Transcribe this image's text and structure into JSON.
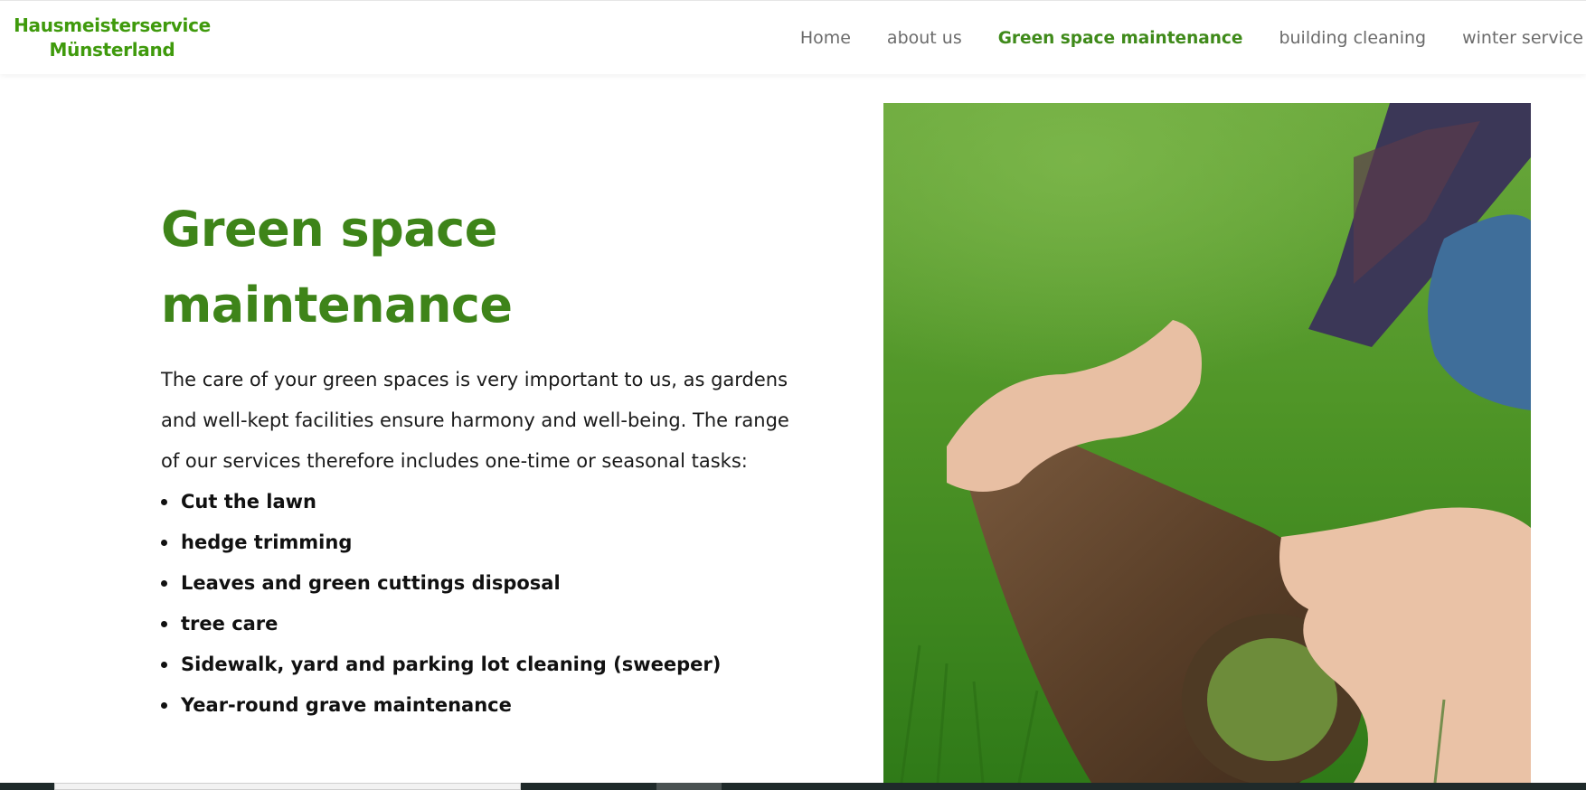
{
  "header": {
    "logo_line1": "Hausmeisterservice",
    "logo_line2": "Münsterland",
    "nav": [
      {
        "label": "Home"
      },
      {
        "label": "about us"
      },
      {
        "label": "Green space maintenance"
      },
      {
        "label": "building cleaning"
      },
      {
        "label": "winter service"
      }
    ],
    "active_nav": "Green space maintenance"
  },
  "main": {
    "title_line1": "Green space",
    "title_line2": "maintenance",
    "intro": "The care of your green spaces is very important to us, as gardens and well-kept facilities ensure harmony and well-being. The range of our services therefore includes one-time or seasonal tasks:",
    "services": [
      "Cut the lawn",
      "hedge trimming",
      "Leaves and green cuttings disposal",
      "tree care",
      "Sidewalk, yard and parking lot cleaning (sweeper)",
      "Year-round grave maintenance"
    ]
  },
  "image": {
    "subject": "hands-rolling-turf-on-lawn"
  },
  "colors": {
    "brand_green": "#3f9a0c",
    "title_green": "#3e8419",
    "nav_active": "#3f8a1a",
    "nav_default": "#6b6b6b"
  }
}
